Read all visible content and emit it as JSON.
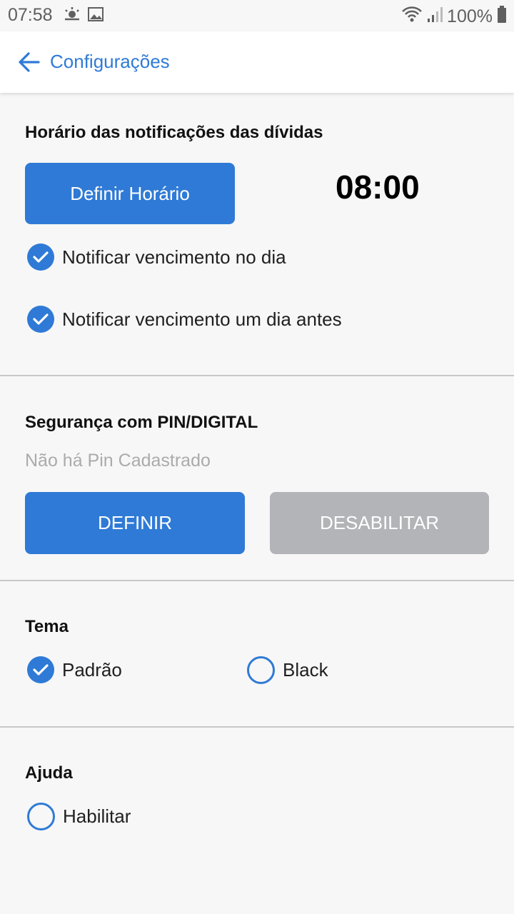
{
  "status_bar": {
    "time": "07:58",
    "battery": "100%",
    "icons": [
      "weather-icon",
      "image-icon",
      "wifi-icon",
      "signal-icon",
      "battery-icon"
    ]
  },
  "app_bar": {
    "title": "Configurações"
  },
  "notifications": {
    "title": "Horário das notificações das dívidas",
    "set_time_label": "Definir Horário",
    "time": "08:00",
    "options": [
      {
        "label": "Notificar vencimento no dia",
        "checked": true
      },
      {
        "label": "Notificar vencimento um dia antes",
        "checked": true
      }
    ]
  },
  "security": {
    "title": "Segurança com PIN/DIGITAL",
    "status": "Não há Pin Cadastrado",
    "define_label": "DEFINIR",
    "disable_label": "DESABILITAR"
  },
  "theme": {
    "title": "Tema",
    "options": [
      {
        "label": "Padrão",
        "selected": true
      },
      {
        "label": "Black",
        "selected": false
      }
    ]
  },
  "help": {
    "title": "Ajuda",
    "enable_label": "Habilitar",
    "enabled": false
  },
  "colors": {
    "accent": "#2f7ad6",
    "disabled": "#b3b4b8"
  }
}
